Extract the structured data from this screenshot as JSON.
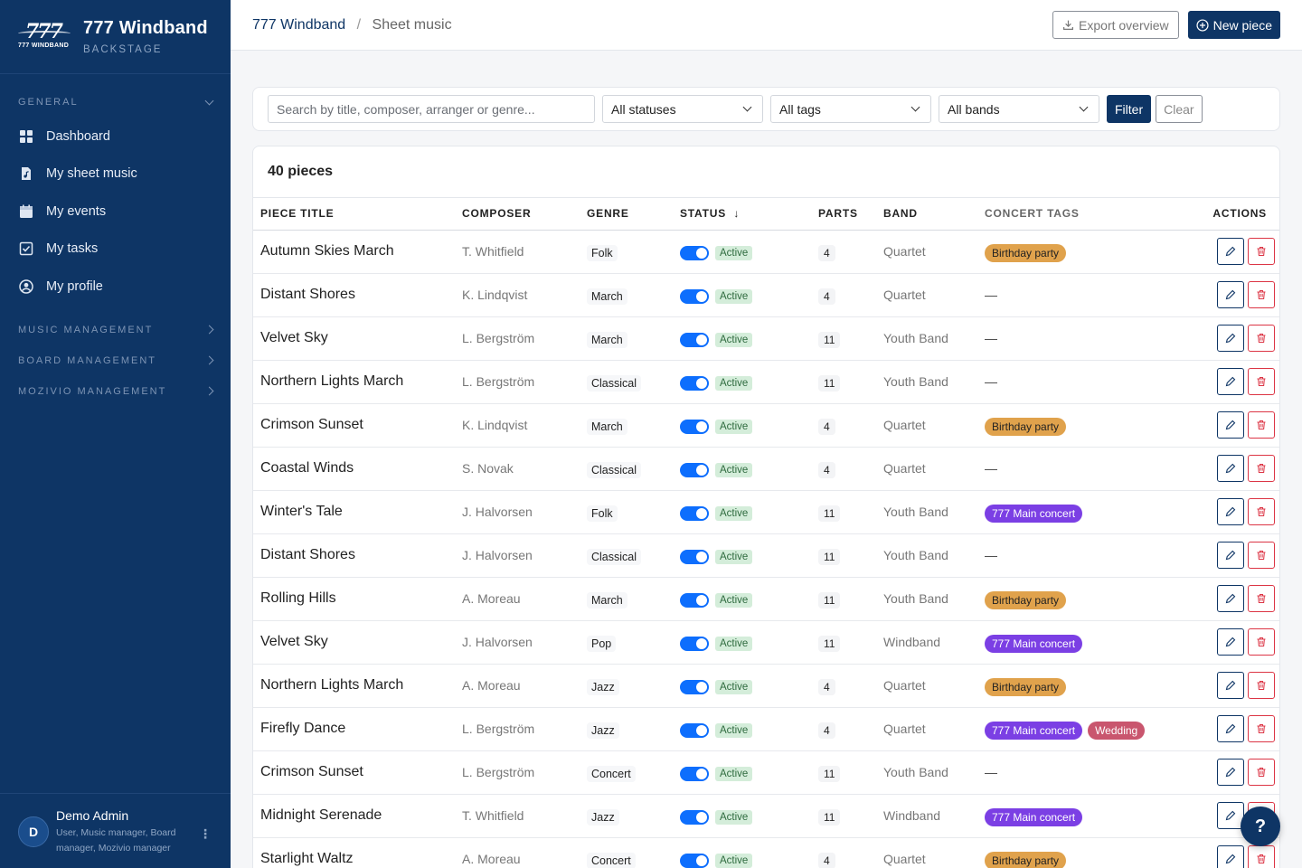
{
  "brand": {
    "logo_number": "777",
    "logo_sub": "777 WINDBAND",
    "title": "777 Windband",
    "subtitle": "BACKSTAGE"
  },
  "sidebar": {
    "general_label": "GENERAL",
    "items": [
      {
        "label": "Dashboard",
        "icon": "dashboard-icon"
      },
      {
        "label": "My sheet music",
        "icon": "sheet-music-icon"
      },
      {
        "label": "My events",
        "icon": "calendar-icon"
      },
      {
        "label": "My tasks",
        "icon": "tasks-icon"
      },
      {
        "label": "My profile",
        "icon": "profile-icon"
      }
    ],
    "sections": [
      "MUSIC MANAGEMENT",
      "BOARD MANAGEMENT",
      "MOZIVIO MANAGEMENT"
    ]
  },
  "user": {
    "initial": "D",
    "name": "Demo Admin",
    "roles": "User, Music manager, Board manager, Mozivio manager"
  },
  "breadcrumb": {
    "root": "777 Windband",
    "separator": "/",
    "current": "Sheet music"
  },
  "top_actions": {
    "export_label": "Export overview",
    "new_label": "New piece"
  },
  "filters": {
    "search_placeholder": "Search by title, composer, arranger or genre...",
    "status": "All statuses",
    "tags": "All tags",
    "bands": "All bands",
    "filter_label": "Filter",
    "clear_label": "Clear"
  },
  "table": {
    "count": "40 pieces",
    "headers": {
      "title": "PIECE TITLE",
      "composer": "COMPOSER",
      "genre": "GENRE",
      "status": "STATUS",
      "status_sort": "↓",
      "parts": "PARTS",
      "band": "BAND",
      "tags": "CONCERT TAGS",
      "actions": "ACTIONS"
    },
    "rows": [
      {
        "title": "Autumn Skies March",
        "composer": "T. Whitfield",
        "genre": "Folk",
        "status": "Active",
        "parts": "4",
        "band": "Quartet",
        "tags": [
          "Birthday party"
        ]
      },
      {
        "title": "Distant Shores",
        "composer": "K. Lindqvist",
        "genre": "March",
        "status": "Active",
        "parts": "4",
        "band": "Quartet",
        "tags": []
      },
      {
        "title": "Velvet Sky",
        "composer": "L. Bergström",
        "genre": "March",
        "status": "Active",
        "parts": "11",
        "band": "Youth Band",
        "tags": []
      },
      {
        "title": "Northern Lights March",
        "composer": "L. Bergström",
        "genre": "Classical",
        "status": "Active",
        "parts": "11",
        "band": "Youth Band",
        "tags": []
      },
      {
        "title": "Crimson Sunset",
        "composer": "K. Lindqvist",
        "genre": "March",
        "status": "Active",
        "parts": "4",
        "band": "Quartet",
        "tags": [
          "Birthday party"
        ]
      },
      {
        "title": "Coastal Winds",
        "composer": "S. Novak",
        "genre": "Classical",
        "status": "Active",
        "parts": "4",
        "band": "Quartet",
        "tags": []
      },
      {
        "title": "Winter's Tale",
        "composer": "J. Halvorsen",
        "genre": "Folk",
        "status": "Active",
        "parts": "11",
        "band": "Youth Band",
        "tags": [
          "777 Main concert"
        ]
      },
      {
        "title": "Distant Shores",
        "composer": "J. Halvorsen",
        "genre": "Classical",
        "status": "Active",
        "parts": "11",
        "band": "Youth Band",
        "tags": []
      },
      {
        "title": "Rolling Hills",
        "composer": "A. Moreau",
        "genre": "March",
        "status": "Active",
        "parts": "11",
        "band": "Youth Band",
        "tags": [
          "Birthday party"
        ]
      },
      {
        "title": "Velvet Sky",
        "composer": "J. Halvorsen",
        "genre": "Pop",
        "status": "Active",
        "parts": "11",
        "band": "Windband",
        "tags": [
          "777 Main concert"
        ]
      },
      {
        "title": "Northern Lights March",
        "composer": "A. Moreau",
        "genre": "Jazz",
        "status": "Active",
        "parts": "4",
        "band": "Quartet",
        "tags": [
          "Birthday party"
        ]
      },
      {
        "title": "Firefly Dance",
        "composer": "L. Bergström",
        "genre": "Jazz",
        "status": "Active",
        "parts": "4",
        "band": "Quartet",
        "tags": [
          "777 Main concert",
          "Wedding"
        ]
      },
      {
        "title": "Crimson Sunset",
        "composer": "L. Bergström",
        "genre": "Concert",
        "status": "Active",
        "parts": "11",
        "band": "Youth Band",
        "tags": []
      },
      {
        "title": "Midnight Serenade",
        "composer": "T. Whitfield",
        "genre": "Jazz",
        "status": "Active",
        "parts": "11",
        "band": "Windband",
        "tags": [
          "777 Main concert"
        ]
      },
      {
        "title": "Starlight Waltz",
        "composer": "A. Moreau",
        "genre": "Concert",
        "status": "Active",
        "parts": "4",
        "band": "Quartet",
        "tags": [
          "Birthday party"
        ]
      }
    ],
    "empty_tag": "—"
  },
  "tag_colors": {
    "Birthday party": "#e0a24c",
    "777 Main concert": "#7b3fe4",
    "Wedding": "#c9566e"
  },
  "help_label": "?"
}
